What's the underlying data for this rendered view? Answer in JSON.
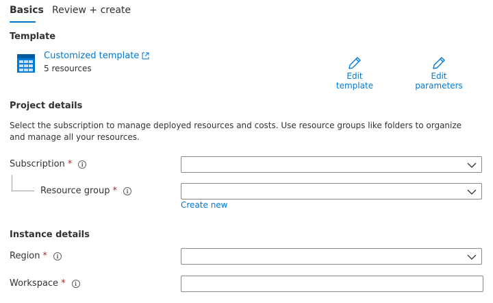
{
  "tabs": [
    {
      "label": "Basics",
      "active": true
    },
    {
      "label": "Review + create",
      "active": false
    }
  ],
  "template": {
    "heading": "Template",
    "name": "Customized template",
    "resources": "5 resources",
    "edit_template": "Edit template",
    "edit_parameters": "Edit parameters"
  },
  "project": {
    "heading": "Project details",
    "description": "Select the subscription to manage deployed resources and costs. Use resource groups like folders to organize and manage all your resources.",
    "subscription_label": "Subscription",
    "resource_group_label": "Resource group",
    "create_new": "Create new",
    "subscription_value": "",
    "resource_group_value": ""
  },
  "instance": {
    "heading": "Instance details",
    "region_label": "Region",
    "workspace_label": "Workspace",
    "region_value": "",
    "workspace_value": ""
  },
  "required_marker": "*",
  "colors": {
    "accent": "#0078d4",
    "required": "#a4262c",
    "text": "#323130",
    "border": "#8a8886"
  },
  "icons": [
    "template-grid-icon",
    "external-link-icon",
    "pencil-icon",
    "info-icon",
    "chevron-down-icon"
  ]
}
